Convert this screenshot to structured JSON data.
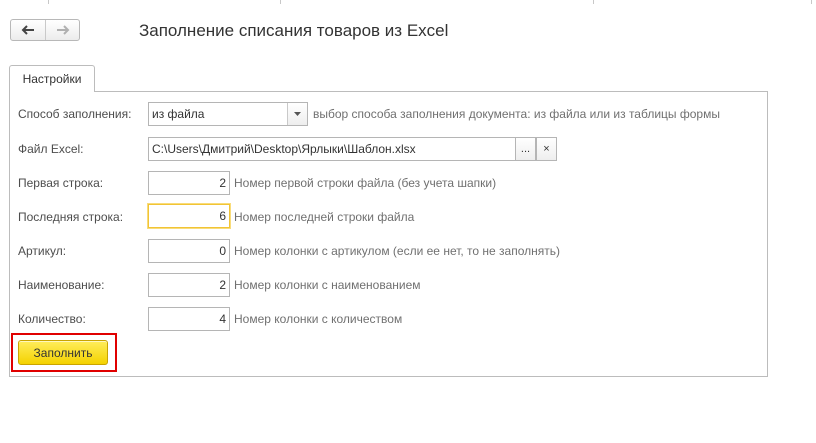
{
  "window": {
    "title": "Заполнение списания товаров из Excel"
  },
  "navigation": {
    "back_icon": "arrow-left-icon",
    "forward_icon": "arrow-right-icon"
  },
  "tabs": [
    {
      "label": "Настройки",
      "active": true
    }
  ],
  "form": {
    "fill_method": {
      "label": "Способ заполнения:",
      "value": "из файла",
      "hint": "выбор способа заполнения документа: из файла или из таблицы формы"
    },
    "excel_file": {
      "label": "Файл Excel:",
      "value": "C:\\Users\\Дмитрий\\Desktop\\Ярлыки\\Шаблон.xlsx",
      "choose_label": "...",
      "clear_label": "×"
    },
    "first_row": {
      "label": "Первая строка:",
      "value": "2",
      "hint": "Номер первой строки файла (без учета шапки)"
    },
    "last_row": {
      "label": "Последняя строка:",
      "value": "6",
      "hint": "Номер последней строки файла"
    },
    "article": {
      "label": "Артикул:",
      "value": "0",
      "hint": "Номер колонки с артикулом (если ее нет, то не заполнять)"
    },
    "name": {
      "label": "Наименование:",
      "value": "2",
      "hint": "Номер колонки с наименованием"
    },
    "quantity": {
      "label": "Количество:",
      "value": "4",
      "hint": "Номер колонки с количеством"
    }
  },
  "actions": {
    "fill_label": "Заполнить"
  },
  "colors": {
    "accent_yellow": "#f4d200",
    "highlight_red": "#e00000",
    "focus_border": "#f1c436"
  }
}
